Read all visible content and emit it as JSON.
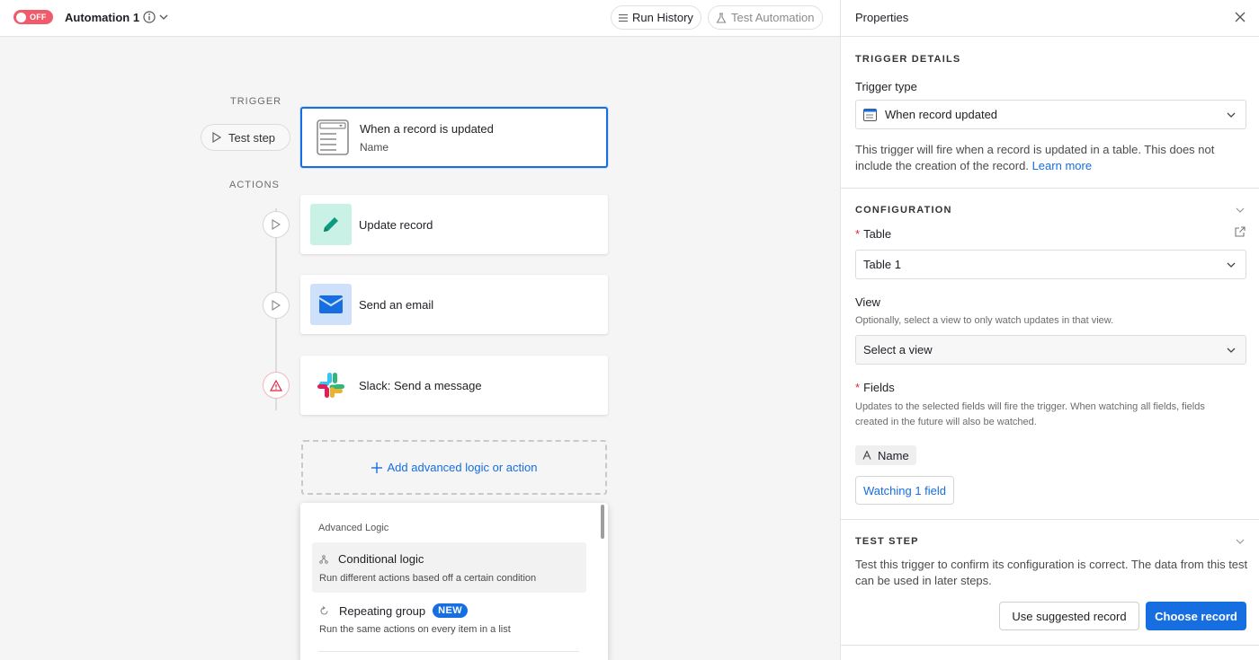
{
  "header": {
    "toggle_label": "OFF",
    "automation_name": "Automation 1",
    "run_history_label": "Run History",
    "test_automation_label": "Test Automation"
  },
  "flow": {
    "trigger_section": "TRIGGER",
    "actions_section": "ACTIONS",
    "test_step_label": "Test step",
    "trigger": {
      "title": "When a record is updated",
      "subtitle": "Name",
      "icon": "table-record-icon"
    },
    "actions": [
      {
        "title": "Update record",
        "icon": "pencil-icon",
        "icon_bg": "#c9f1e6",
        "status": "play"
      },
      {
        "title": "Send an email",
        "icon": "envelope-icon",
        "icon_bg": "#cfe0fb",
        "status": "play"
      },
      {
        "title": "Slack: Send a message",
        "icon": "slack-icon",
        "status": "warning"
      }
    ],
    "add_label": "Add advanced logic or action"
  },
  "menu": {
    "header": "Advanced Logic",
    "items": [
      {
        "title": "Conditional logic",
        "description": "Run different actions based off a certain condition",
        "icon": "branch-icon"
      },
      {
        "title": "Repeating group",
        "badge": "NEW",
        "description": "Run the same actions on every item in a list",
        "icon": "repeat-icon"
      }
    ]
  },
  "panel": {
    "title": "Properties",
    "trigger_details": {
      "heading": "TRIGGER DETAILS",
      "trigger_type_label": "Trigger type",
      "trigger_type_value": "When record updated",
      "description": "This trigger will fire when a record is updated in a table. This does not include the creation of the record.",
      "learn_more": "Learn more"
    },
    "configuration": {
      "heading": "CONFIGURATION",
      "table_label": "Table",
      "table_value": "Table 1",
      "view_label": "View",
      "view_help": "Optionally, select a view to only watch updates in that view.",
      "view_placeholder": "Select a view",
      "fields_label": "Fields",
      "fields_help_1": "Updates to the selected fields will fire the trigger. When watching all fields, fields",
      "fields_help_2": "created in the future will also be watched.",
      "field_chip": "Name",
      "watching_label": "Watching 1 field"
    },
    "test_step": {
      "heading": "TEST STEP",
      "description": "Test this trigger to confirm its configuration is correct. The data from this test can be used in later steps.",
      "suggested_label": "Use suggested record",
      "choose_label": "Choose record"
    }
  },
  "colors": {
    "accent": "#166ee1",
    "toggle_off": "#ef5b6b",
    "warning": "#e0243f"
  }
}
